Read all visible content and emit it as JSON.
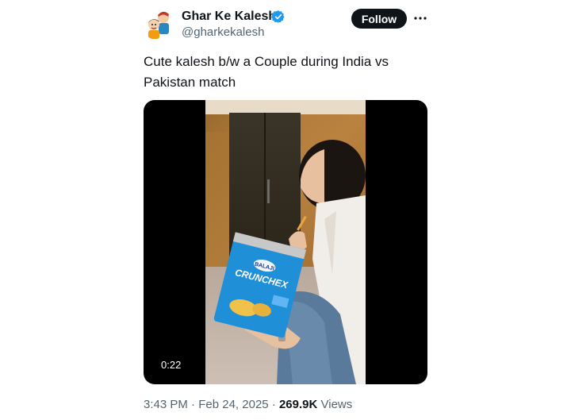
{
  "author": {
    "display_name": "Ghar Ke Kalesh",
    "handle": "@gharkekalesh",
    "verified": true,
    "verified_color": "#1d9bf0"
  },
  "actions": {
    "follow_label": "Follow",
    "more_icon": "more-horizontal-icon"
  },
  "tweet": {
    "text": "Cute kalesh b/w a Couple during India vs Pakistan match"
  },
  "media": {
    "type": "video",
    "duration": "0:22",
    "chip_bag_brand": "BALAJI",
    "chip_bag_product": "CRUNCHEX"
  },
  "meta": {
    "time": "3:43 PM",
    "separator": "·",
    "date": "Feb 24, 2025",
    "views_count": "269.9K",
    "views_label": "Views"
  },
  "colors": {
    "text_primary": "#0f1419",
    "text_secondary": "#536471",
    "follow_bg": "#0f1419"
  }
}
